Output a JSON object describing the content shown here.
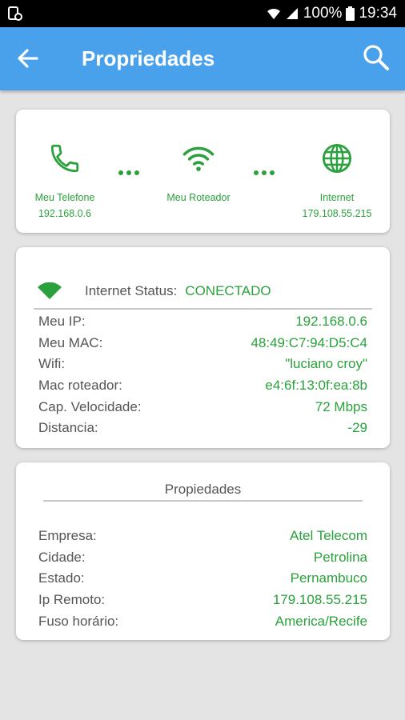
{
  "status_bar": {
    "battery": "100%",
    "time": "19:34"
  },
  "app_bar": {
    "title": "Propriedades"
  },
  "network": {
    "phone": {
      "label": "Meu Telefone",
      "ip": "192.168.0.6"
    },
    "router": {
      "label": "Meu Roteador"
    },
    "internet": {
      "label": "Internet",
      "ip": "179.108.55.215"
    }
  },
  "connection": {
    "status_label": "Internet Status:",
    "status_value": "CONECTADO",
    "rows": [
      {
        "label": "Meu IP:",
        "value": "192.168.0.6"
      },
      {
        "label": "Meu MAC:",
        "value": "48:49:C7:94:D5:C4"
      },
      {
        "label": "Wifi:",
        "value": "\"luciano croy\""
      },
      {
        "label": "Mac roteador:",
        "value": "e4:6f:13:0f:ea:8b"
      },
      {
        "label": "Cap. Velocidade:",
        "value": "72 Mbps"
      },
      {
        "label": "Distancia:",
        "value": "-29"
      }
    ]
  },
  "properties": {
    "title": "Propiedades",
    "rows": [
      {
        "label": "Empresa:",
        "value": "Atel Telecom"
      },
      {
        "label": "Cidade:",
        "value": "Petrolina"
      },
      {
        "label": "Estado:",
        "value": "Pernambuco"
      },
      {
        "label": "Ip Remoto:",
        "value": "179.108.55.215"
      },
      {
        "label": "Fuso horário:",
        "value": "America/Recife"
      }
    ]
  },
  "colors": {
    "app_bar": "#4aa1eb",
    "accent_green": "#2aa13c",
    "background": "#e4e4e4"
  },
  "icons": [
    "back-arrow-icon",
    "search-icon",
    "phone-icon",
    "wifi-icon",
    "globe-icon",
    "wifi-signal-icon"
  ]
}
